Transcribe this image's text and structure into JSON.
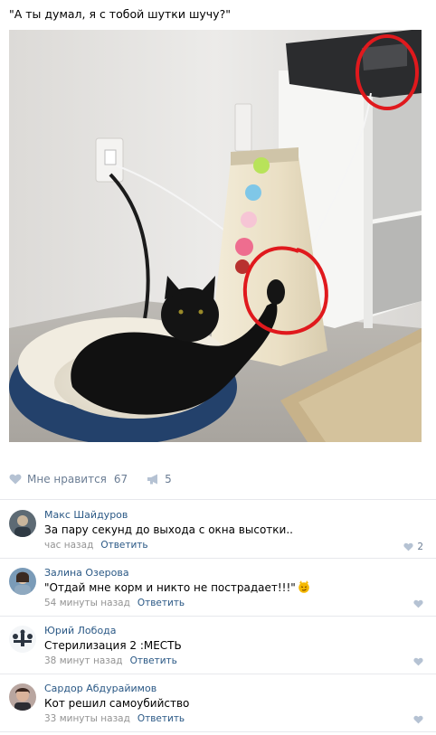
{
  "post": {
    "text": "\"А ты думал, я с тобой шутки шучу?\""
  },
  "actions": {
    "like_label": "Мне нравится",
    "like_count": "67",
    "share_count": "5"
  },
  "comments": [
    {
      "name": "Макс Шайдуров",
      "text": "За пару секунд до выхода с окна высотки..",
      "time": "час назад",
      "reply": "Ответить",
      "likes": "2"
    },
    {
      "name": "Залина Озерова",
      "text": "\"Отдай мне корм и никто не пострадает!!!\"",
      "time": "54 минуты назад",
      "reply": "Ответить",
      "likes": ""
    },
    {
      "name": "Юрий Лобода",
      "text": "Стерилизация 2 :МЕСТЬ",
      "time": "38 минут назад",
      "reply": "Ответить",
      "likes": ""
    },
    {
      "name": "Сардор Абдурайимов",
      "text": "Кот решил самоубийство",
      "time": "33 минуты назад",
      "reply": "Ответить",
      "likes": ""
    }
  ],
  "colors": {
    "link": "#2a5885",
    "meta": "#939393",
    "action": "#6b7d94",
    "annotation_circle": "#e0191d"
  }
}
